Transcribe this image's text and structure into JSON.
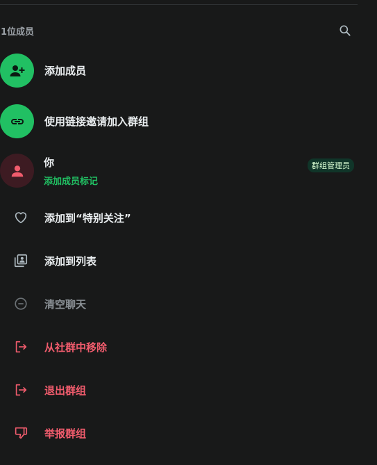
{
  "members": {
    "count_label": "1位成员"
  },
  "rows": {
    "add_member": "添加成员",
    "invite_link": "使用链接邀请加入群组",
    "self_name": "你",
    "self_sub": "添加成员标记",
    "admin_badge": "群组管理员"
  },
  "actions": {
    "favorite": "添加到“特别关注”",
    "add_to_list": "添加到列表",
    "clear_chat": "清空聊天",
    "remove_from_community": "从社群中移除",
    "exit_group": "退出群组",
    "report_group": "举报群组"
  },
  "icons": {
    "search": "search-icon",
    "add_member": "person-add-icon",
    "link": "link-icon",
    "person": "person-icon",
    "heart": "heart-icon",
    "list": "list-icon",
    "clear": "minus-circle-icon",
    "exit": "exit-icon",
    "report": "thumbs-down-icon"
  },
  "colors": {
    "accent_green": "#21c063",
    "danger_red": "#f15c6d",
    "background": "#181919"
  }
}
